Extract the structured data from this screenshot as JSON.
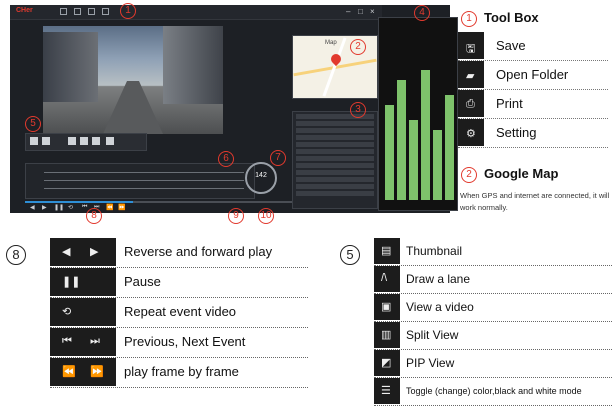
{
  "app": {
    "logo": "CHer",
    "map_label": "Map",
    "speed": "142"
  },
  "callouts": [
    "1",
    "2",
    "3",
    "4",
    "5",
    "6",
    "7",
    "8",
    "9",
    "10"
  ],
  "toolbox": {
    "number": "1",
    "title": "Tool Box",
    "items": [
      {
        "icon": "save-icon",
        "glyph": "🖫",
        "label": "Save"
      },
      {
        "icon": "open-folder-icon",
        "glyph": "▰",
        "label": "Open Folder"
      },
      {
        "icon": "print-icon",
        "glyph": "⎙",
        "label": "Print"
      },
      {
        "icon": "setting-icon",
        "glyph": "⚙",
        "label": "Setting"
      }
    ]
  },
  "google_map": {
    "number": "2",
    "title": "Google Map",
    "description": "When GPS and internet are connected, it will work normally."
  },
  "legend_8": {
    "number": "8",
    "items": [
      {
        "icons": [
          "◀",
          "▶"
        ],
        "label": "Reverse and forward play"
      },
      {
        "icons": [
          "❚❚"
        ],
        "label": "Pause"
      },
      {
        "icons": [
          "⟲"
        ],
        "label": "Repeat event video"
      },
      {
        "icons": [
          "⏮",
          "⏭"
        ],
        "label": "Previous, Next Event"
      },
      {
        "icons": [
          "⏪",
          "⏩"
        ],
        "label": "play frame by frame"
      }
    ]
  },
  "legend_5": {
    "number": "5",
    "items": [
      {
        "icon": "thumbnail-icon",
        "glyph": "▤",
        "label": "Thumbnail"
      },
      {
        "icon": "lane-icon",
        "glyph": "/\\",
        "label": "Draw a lane"
      },
      {
        "icon": "view-video-icon",
        "glyph": "▣",
        "label": "View a video"
      },
      {
        "icon": "split-view-icon",
        "glyph": "▥",
        "label": "Split View"
      },
      {
        "icon": "pip-view-icon",
        "glyph": "◩",
        "label": "PIP View"
      },
      {
        "icon": "toggle-color-icon",
        "glyph": "☰",
        "label": "Toggle (change) color,black and white mode"
      }
    ]
  }
}
